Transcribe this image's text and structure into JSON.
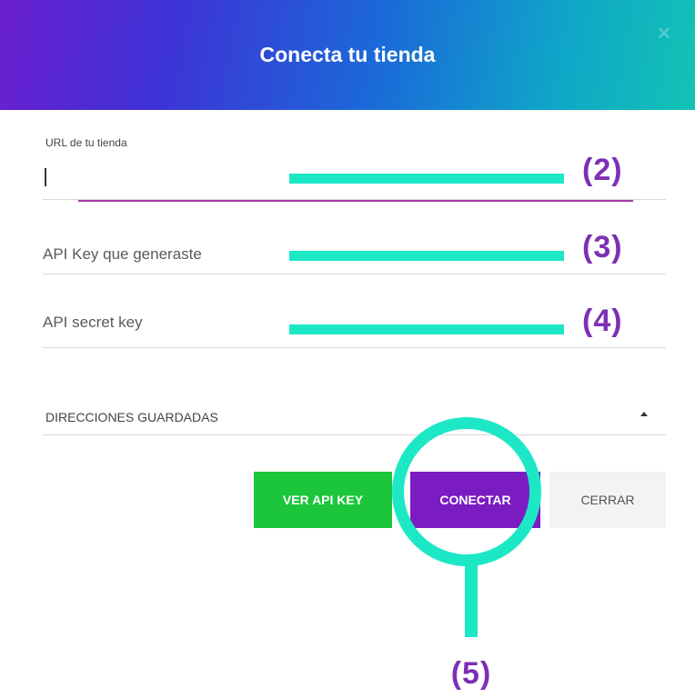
{
  "dialog": {
    "title": "Conecta tu tienda",
    "close_icon": "close-icon"
  },
  "form": {
    "url_field": {
      "label": "URL de tu tienda",
      "value": ""
    },
    "api_key_field": {
      "placeholder": "API Key que generaste",
      "value": ""
    },
    "api_secret_field": {
      "placeholder": "API secret key",
      "value": ""
    },
    "saved_addresses": {
      "label": "DIRECCIONES GUARDADAS",
      "icon": "caret-up-icon"
    }
  },
  "buttons": {
    "view_api_key": "VER API KEY",
    "connect": "CONECTAR",
    "close": "CERRAR"
  },
  "annotations": {
    "step_2": "(2)",
    "step_3": "(3)",
    "step_4": "(4)",
    "step_5": "(5)"
  },
  "colors": {
    "header_gradient_start": "#6b1fd0",
    "header_gradient_end": "#12c3b4",
    "active_underline": "#a03aa8",
    "button_green": "#1bc63b",
    "button_purple": "#7a1cc2",
    "button_gray": "#f3f3f3",
    "annotation_teal": "#1ce8c6",
    "annotation_purple": "#7d2fb5"
  }
}
